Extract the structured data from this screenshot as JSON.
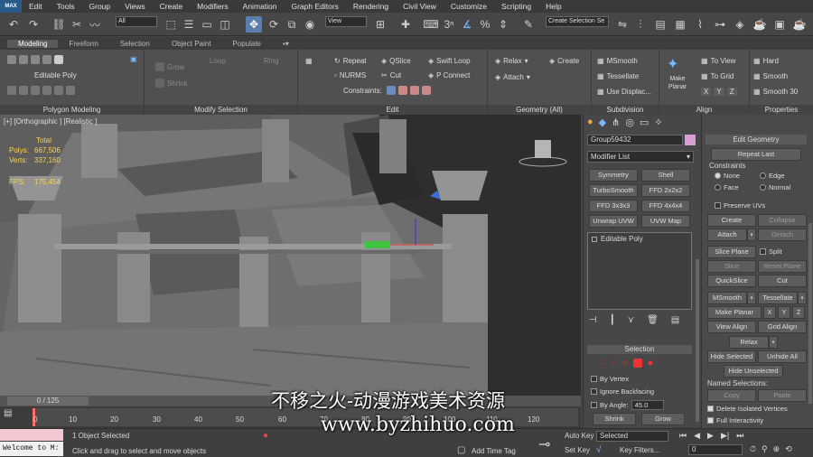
{
  "menu": {
    "logo": "MAX",
    "items": [
      "Edit",
      "Tools",
      "Group",
      "Views",
      "Create",
      "Modifiers",
      "Animation",
      "Graph Editors",
      "Rendering",
      "Civil View",
      "Customize",
      "Scripting",
      "Help"
    ]
  },
  "toolbar": {
    "filter_select": "All",
    "view_select": "View",
    "named_selection_placeholder": "Create Selection Se"
  },
  "ribbon_tabs": [
    "Modeling",
    "Freeform",
    "Selection",
    "Object Paint",
    "Populate"
  ],
  "ribbon": {
    "polygon_modeling": {
      "title": "Editable Poly",
      "label": "Polygon Modeling"
    },
    "modify_selection": {
      "grow": "Grow",
      "shrink": "Shrink",
      "loop": "Loop",
      "ring": "Ring",
      "label": "Modify Selection"
    },
    "edit": {
      "repeat": "Repeat",
      "qslice": "QSlice",
      "swift_loop": "Swift Loop",
      "nurms": "NURMS",
      "cut": "Cut",
      "p_connect": "P Connect",
      "constraints": "Constraints:",
      "label": "Edit"
    },
    "geometry": {
      "relax": "Relax",
      "create": "Create",
      "attach": "Attach",
      "label": "Geometry (All)"
    },
    "subdivision": {
      "msmooth": "MSmooth",
      "tessellate": "Tessellate",
      "use_displace": "Use Displac...",
      "label": "Subdivision"
    },
    "align": {
      "make_planar": "Make Planar",
      "to_view": "To View",
      "to_grid": "To Grid",
      "x": "X",
      "y": "Y",
      "z": "Z",
      "label": "Align"
    },
    "properties": {
      "hard": "Hard",
      "smooth": "Smooth",
      "smooth30": "Smooth 30",
      "label": "Properties"
    }
  },
  "viewport": {
    "label": "[+] [Orthographic ] [Realistic ]",
    "stats": {
      "total": "Total",
      "polys_label": "Polys:",
      "polys": "667,506",
      "verts_label": "Verts:",
      "verts": "337,160",
      "fps_label": "FPS:",
      "fps": "175,454"
    }
  },
  "command_panel": {
    "object_name": "Group59432",
    "modifier_list": "Modifier List",
    "buttons": [
      "Symmetry",
      "Shell",
      "TurboSmooth",
      "FFD 2x2x2",
      "FFD 3x3x3",
      "FFD 4x4x4",
      "Unwrap UVW",
      "UVW Map"
    ],
    "stack_item": "Editable Poly",
    "selection_title": "Selection",
    "by_vertex": "By Vertex",
    "ignore_backfacing": "Ignore Backfacing",
    "by_angle": "By Angle:",
    "angle": "45.0",
    "shrink": "Shrink",
    "grow": "Grow"
  },
  "edit_geometry": {
    "title": "Edit Geometry",
    "repeat_last": "Repeat Last",
    "constraints": "Constraints",
    "none": "None",
    "edge": "Edge",
    "face": "Face",
    "normal": "Normal",
    "preserve_uvs": "Preserve UVs",
    "create": "Create",
    "collapse": "Collapse",
    "attach": "Attach",
    "detach": "Detach",
    "slice_plane": "Slice Plane",
    "split": "Split",
    "slice": "Slice",
    "reset_plane": "Reset Plane",
    "quickslice": "QuickSlice",
    "cut": "Cut",
    "msmooth": "MSmooth",
    "tessellate": "Tessellate",
    "make_planar": "Make Planar",
    "x": "X",
    "y": "Y",
    "z": "Z",
    "view_align": "View Align",
    "grid_align": "Grid Align",
    "relax": "Relax",
    "hide_selected": "Hide Selected",
    "unhide_all": "Unhide All",
    "hide_unselected": "Hide Unselected",
    "named_selections": "Named Selections:",
    "copy": "Copy",
    "paste": "Paste",
    "delete_isolated": "Delete Isolated Vertices",
    "full_interactivity": "Full Interactivity"
  },
  "timeline": {
    "frame": "0 / 125",
    "ticks": [
      "0",
      "10",
      "20",
      "30",
      "40",
      "50",
      "60",
      "70",
      "80",
      "90",
      "100",
      "110",
      "120"
    ]
  },
  "status": {
    "welcome": "Welcome to M:",
    "objects_selected": "1 Object Selected",
    "prompt": "Click and drag to select and move objects",
    "add_time_tag": "Add Time Tag",
    "auto_key": "Auto Key",
    "set_key": "Set Key",
    "selected": "Selected",
    "key_filters": "Key Filters...",
    "frame_value": "0"
  },
  "watermark": {
    "line1": "不移之火-动漫游戏美术资源",
    "line2": "www.byzhihuo.com"
  }
}
